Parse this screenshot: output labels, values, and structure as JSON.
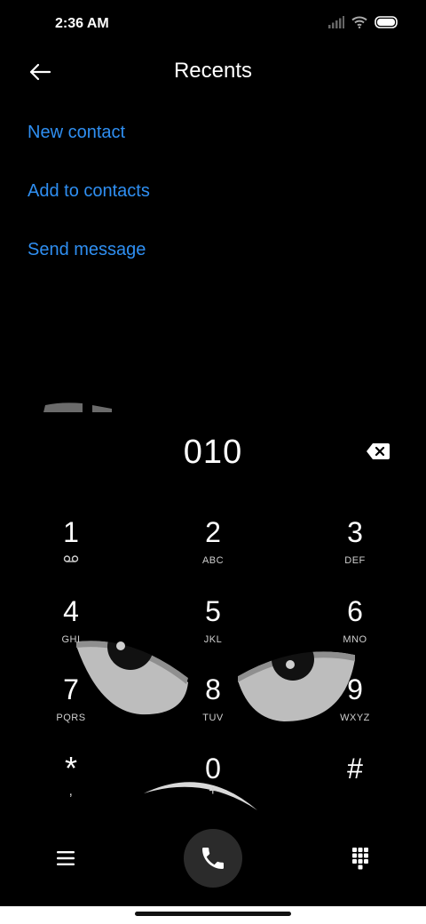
{
  "status_bar": {
    "time": "2:36 AM",
    "icons": [
      "signal-icon",
      "wifi-icon",
      "battery-icon"
    ]
  },
  "header": {
    "title": "Recents",
    "back_icon": "back-arrow-icon"
  },
  "actions": {
    "new_contact": "New contact",
    "add_to_contacts": "Add to contacts",
    "send_message": "Send message"
  },
  "dialer": {
    "number": "010",
    "backspace_icon": "backspace-icon"
  },
  "keypad": {
    "keys": [
      {
        "digit": "1",
        "sub": ""
      },
      {
        "digit": "2",
        "sub": "ABC"
      },
      {
        "digit": "3",
        "sub": "DEF"
      },
      {
        "digit": "4",
        "sub": "GHI"
      },
      {
        "digit": "5",
        "sub": "JKL"
      },
      {
        "digit": "6",
        "sub": "MNO"
      },
      {
        "digit": "7",
        "sub": "PQRS"
      },
      {
        "digit": "8",
        "sub": "TUV"
      },
      {
        "digit": "9",
        "sub": "WXYZ"
      },
      {
        "digit": "*",
        "sub": ","
      },
      {
        "digit": "0",
        "sub": "+"
      },
      {
        "digit": "#",
        "sub": ""
      }
    ]
  },
  "bottom_bar": {
    "menu_icon": "menu-icon",
    "call_icon": "phone-icon",
    "keypad_icon": "dialpad-icon"
  },
  "colors": {
    "background": "#000000",
    "accent": "#2f8ff2",
    "call_button": "#2b2b2b"
  }
}
